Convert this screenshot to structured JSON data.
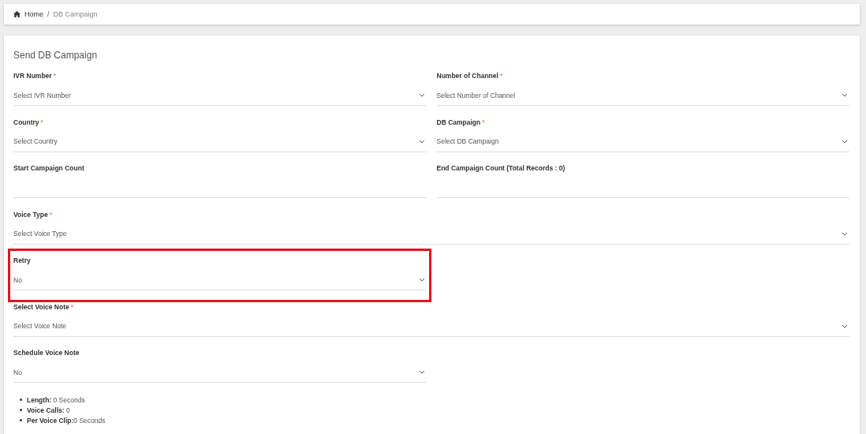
{
  "breadcrumb": {
    "items": [
      {
        "label": "Home",
        "kind": "link"
      },
      {
        "label": "DB Campaign",
        "kind": "current"
      }
    ],
    "separator": "/"
  },
  "form": {
    "title": "Send DB Campaign",
    "rows": [
      {
        "fields": [
          {
            "label": "IVR Number",
            "required_mark": "*",
            "kind": "select",
            "placeholder": "Select IVR Number",
            "highlighted": false
          },
          {
            "label": "Number of Channel",
            "required_mark": "*",
            "kind": "select",
            "placeholder": "Select Number of Channel",
            "highlighted": false
          }
        ]
      },
      {
        "fields": [
          {
            "label": "Country",
            "required_mark": "*",
            "kind": "select",
            "placeholder": "Select Country",
            "highlighted": false
          },
          {
            "label": "DB Campaign",
            "required_mark": "*",
            "kind": "select",
            "placeholder": "Select DB Campaign",
            "highlighted": false
          }
        ]
      },
      {
        "fields": [
          {
            "label": "Start Campaign Count",
            "kind": "input",
            "highlighted": false
          },
          {
            "label": "End Campaign Count (Total Records : 0)",
            "kind": "input",
            "highlighted": false
          }
        ]
      },
      {
        "fields": [
          {
            "label": "Voice Type",
            "required_mark": "*",
            "kind": "select",
            "placeholder": "Select Voice Type",
            "highlighted": false,
            "full": true
          }
        ]
      },
      {
        "fields": [
          {
            "label": "Retry",
            "kind": "select",
            "value": "No",
            "highlighted": true
          }
        ]
      },
      {
        "fields": [
          {
            "label": "Select Voice Note",
            "required_mark": "*",
            "kind": "select",
            "placeholder": "Select Voice Note",
            "highlighted": false,
            "full": true
          }
        ]
      },
      {
        "fields": [
          {
            "label": "Schedule Voice Note",
            "kind": "select",
            "value": "No",
            "highlighted": false
          }
        ]
      }
    ],
    "summary": [
      "**Length:** 0 Seconds",
      "**Voice Calls:** 0",
      "**Per Voice Clip:**0 Seconds"
    ]
  }
}
